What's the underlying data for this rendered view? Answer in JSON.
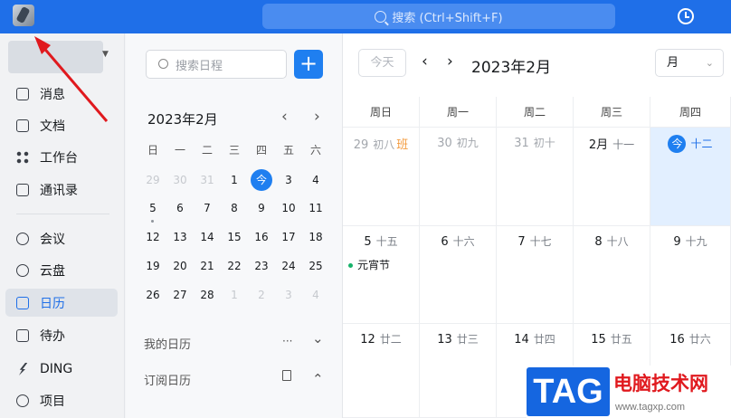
{
  "topbar": {
    "search_placeholder": "搜索 (Ctrl+Shift+F)",
    "search_icon": "search-icon",
    "history_icon": "history-icon",
    "avatar_icon": "app-avatar",
    "accent": "#1f6fe8"
  },
  "sidebar": {
    "items": [
      {
        "label": "消息",
        "icon": "message-icon"
      },
      {
        "label": "文档",
        "icon": "document-icon"
      },
      {
        "label": "工作台",
        "icon": "workbench-icon"
      },
      {
        "label": "通讯录",
        "icon": "contacts-icon"
      },
      {
        "label": "会议",
        "icon": "phone-icon"
      },
      {
        "label": "云盘",
        "icon": "cloud-icon"
      },
      {
        "label": "日历",
        "icon": "calendar-icon",
        "active": true
      },
      {
        "label": "待办",
        "icon": "todo-icon"
      },
      {
        "label": "DING",
        "icon": "ding-icon"
      },
      {
        "label": "项目",
        "icon": "project-icon"
      }
    ]
  },
  "calpane": {
    "search_placeholder": "搜索日程",
    "add_label": "+",
    "month_title": "2023年2月",
    "prev": "‹",
    "next": "›",
    "weekdays": [
      "日",
      "一",
      "二",
      "三",
      "四",
      "五",
      "六"
    ],
    "weeks": [
      [
        "29",
        "30",
        "31",
        "1",
        "今",
        "3",
        "4"
      ],
      [
        "5",
        "6",
        "7",
        "8",
        "9",
        "10",
        "11"
      ],
      [
        "12",
        "13",
        "14",
        "15",
        "16",
        "17",
        "18"
      ],
      [
        "19",
        "20",
        "21",
        "22",
        "23",
        "24",
        "25"
      ],
      [
        "26",
        "27",
        "28",
        "1",
        "2",
        "3",
        "4"
      ]
    ],
    "my_calendar": "我的日历",
    "my_calendar_more": "···",
    "my_calendar_toggle": "⌄",
    "subscribed": "订阅日历",
    "subscribed_toggle": "⌃"
  },
  "main": {
    "today_btn": "今天",
    "prev": "‹",
    "next": "›",
    "title": "2023年2月",
    "view": "月",
    "view_caret": "⌄",
    "headers": [
      "周日",
      "周一",
      "周二",
      "周三",
      "周四"
    ],
    "rows": [
      [
        {
          "day": "29",
          "lunar": "初八",
          "tag": "班",
          "other": true
        },
        {
          "day": "30",
          "lunar": "初九",
          "other": true
        },
        {
          "day": "31",
          "lunar": "初十",
          "other": true
        },
        {
          "day": "2月",
          "lunar": "十一"
        },
        {
          "day": "今",
          "lunar": "十二",
          "today": true
        }
      ],
      [
        {
          "day": "5",
          "lunar": "十五",
          "event": "元宵节"
        },
        {
          "day": "6",
          "lunar": "十六"
        },
        {
          "day": "7",
          "lunar": "十七"
        },
        {
          "day": "8",
          "lunar": "十八"
        },
        {
          "day": "9",
          "lunar": "十九"
        }
      ],
      [
        {
          "day": "12",
          "lunar": "廿二"
        },
        {
          "day": "13",
          "lunar": "廿三"
        },
        {
          "day": "14",
          "lunar": "廿四"
        },
        {
          "day": "15",
          "lunar": "廿五"
        },
        {
          "day": "16",
          "lunar": "廿六"
        }
      ]
    ]
  },
  "watermark": {
    "logo": "TAG",
    "title": "电脑技术网",
    "url": "www.tagxp.com"
  }
}
